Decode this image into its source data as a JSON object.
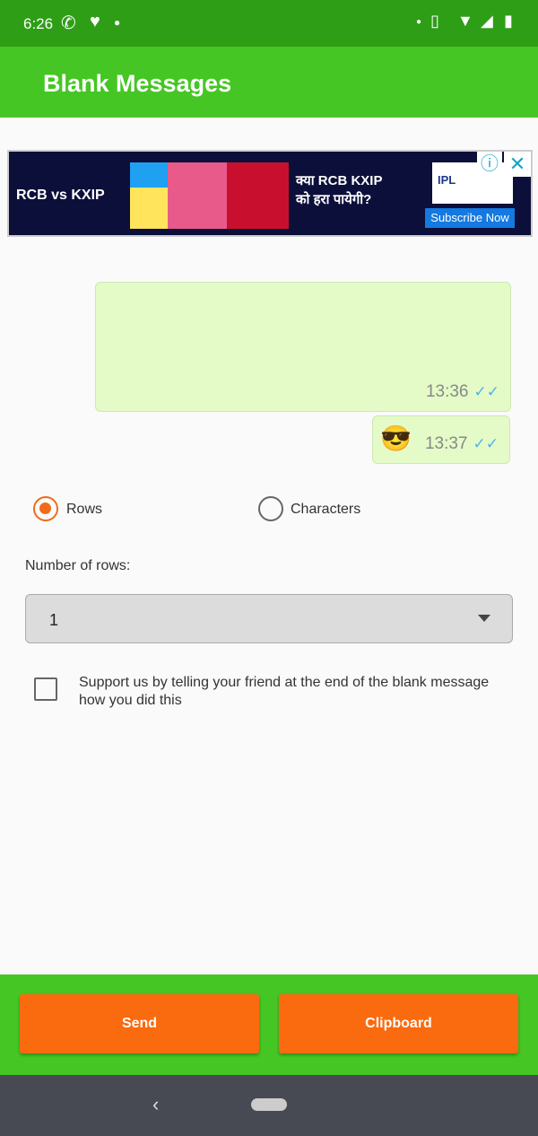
{
  "status_bar": {
    "time": "6:26"
  },
  "app_bar": {
    "title": "Blank Messages"
  },
  "ad": {
    "headline": "RCB vs KXIP",
    "question_line1": "क्या RCB KXIP",
    "question_line2": "को हरा पायेगी?",
    "logo": "IPL",
    "subscribe_label": "Subscribe Now",
    "info_icon": "ⓘ",
    "close_icon": "✕"
  },
  "messages": [
    {
      "text": "",
      "time": "13:36"
    },
    {
      "text": "😎",
      "time": "13:37"
    }
  ],
  "mode": {
    "options": [
      "Rows",
      "Characters"
    ],
    "selected": "Rows"
  },
  "rows": {
    "label": "Number of rows:",
    "value": "1"
  },
  "support": {
    "label_line1": "Support us by telling your friend at the end of the blank message",
    "label_line2": "how you did this",
    "checked": false
  },
  "buttons": {
    "send": "Send",
    "clipboard": "Clipboard"
  },
  "colors": {
    "status_bar": "#2e9e16",
    "app_bar": "#45c624",
    "accent": "#f26a1b",
    "button": "#fa6a0e",
    "bubble": "#e4fbc8"
  }
}
